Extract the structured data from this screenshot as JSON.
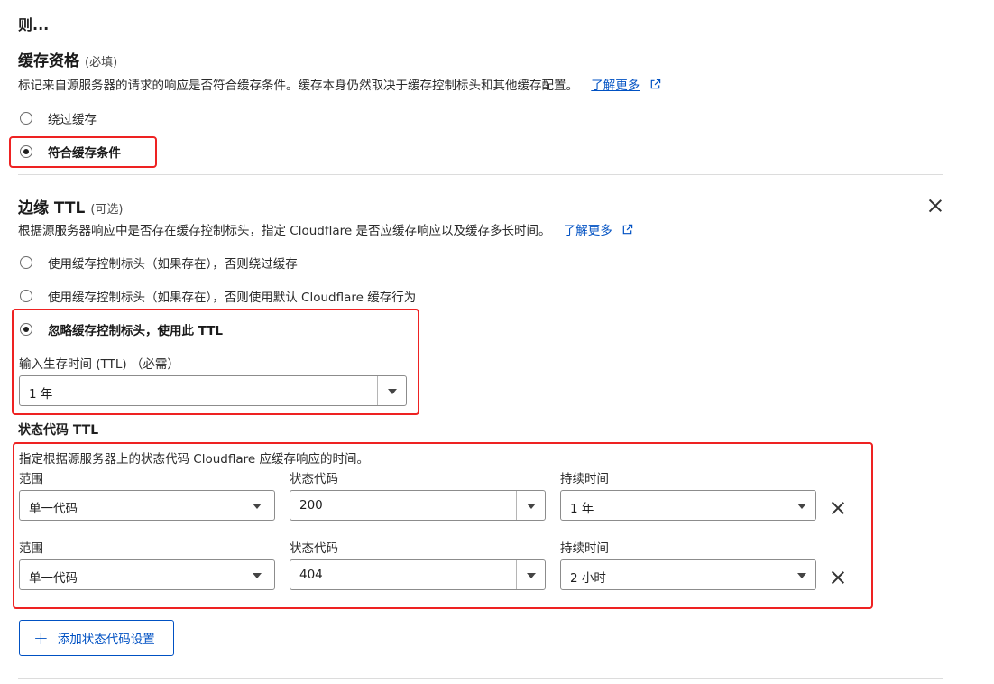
{
  "top_heading": "则...",
  "cache_eligibility": {
    "title": "缓存资格",
    "required": "(必填)",
    "description": "标记来自源服务器的请求的响应是否符合缓存条件。缓存本身仍然取决于缓存控制标头和其他缓存配置。",
    "learn_more": "了解更多",
    "options": [
      {
        "label": "绕过缓存",
        "checked": false
      },
      {
        "label": "符合缓存条件",
        "checked": true
      }
    ]
  },
  "edge_ttl": {
    "title": "边缘 TTL",
    "optional": "(可选)",
    "description": "根据源服务器响应中是否存在缓存控制标头，指定 Cloudflare 是否应缓存响应以及缓存多长时间。",
    "learn_more": "了解更多",
    "options": [
      {
        "label": "使用缓存控制标头（如果存在），否则绕过缓存",
        "checked": false
      },
      {
        "label": "使用缓存控制标头（如果存在），否则使用默认 Cloudflare 缓存行为",
        "checked": false
      },
      {
        "label": "忽略缓存控制标头，使用此 TTL",
        "checked": true
      }
    ],
    "ttl_input_label": "输入生存时间 (TTL) （必需）",
    "ttl_value": "1 年"
  },
  "status_code_ttl": {
    "title": "状态代码 TTL",
    "description": "指定根据源服务器上的状态代码 Cloudflare 应缓存响应的时间。",
    "column_labels": {
      "range": "范围",
      "status": "状态代码",
      "duration": "持续时间"
    },
    "rows": [
      {
        "range": "单一代码",
        "status": "200",
        "duration": "1 年"
      },
      {
        "range": "单一代码",
        "status": "404",
        "duration": "2 小时"
      }
    ],
    "add_button": "添加状态代码设置"
  },
  "colors": {
    "accent": "#0051c3",
    "highlight_box": "#ee2222"
  }
}
